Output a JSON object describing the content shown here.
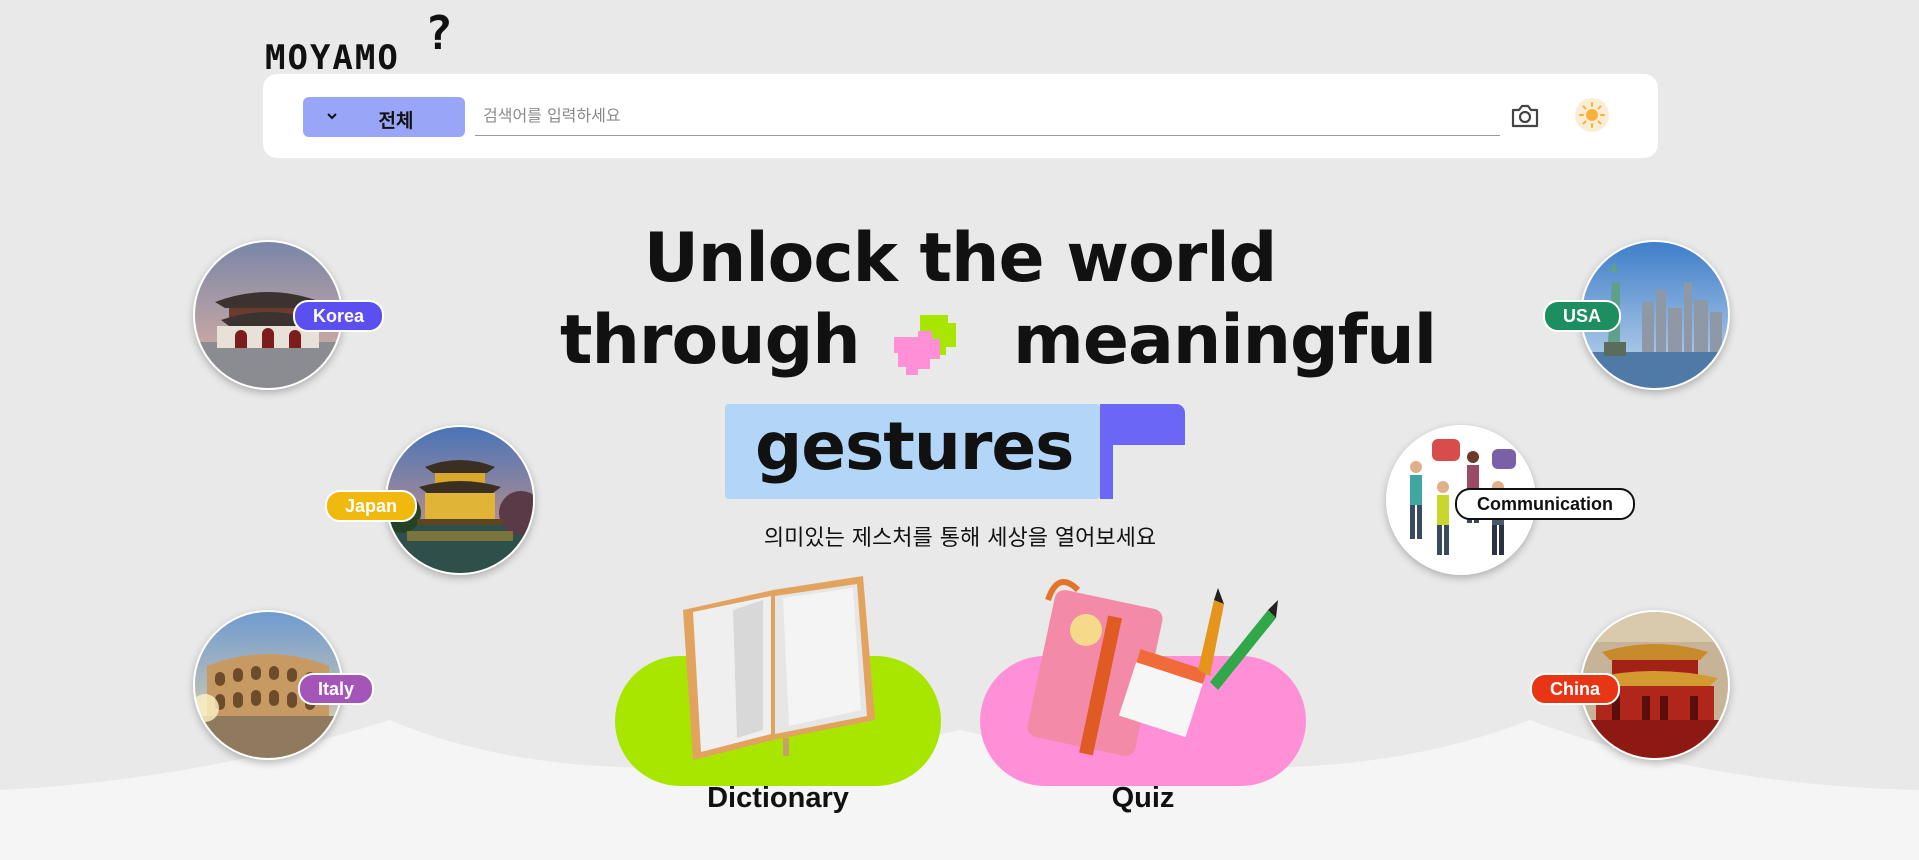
{
  "logo": {
    "text": "MOYAMO",
    "mark": "?"
  },
  "search": {
    "category": "전체",
    "placeholder": "검색어를 입력하세요",
    "camera_icon": "camera-icon",
    "theme_icon": "sun-icon"
  },
  "hero": {
    "line1": "Unlock the world",
    "line2a": "through",
    "line2b": "meaningful",
    "line3": "gestures",
    "subtitle": "의미있는 제스처를 통해 세상을 열어보세요"
  },
  "countries": {
    "korea": "Korea",
    "japan": "Japan",
    "italy": "Italy",
    "usa": "USA",
    "communication": "Communication",
    "china": "China"
  },
  "colors": {
    "korea": "#5b4ff0",
    "japan": "#f0b90e",
    "italy": "#a456b8",
    "usa": "#1d8e60",
    "china": "#e83515",
    "dictionary_blob": "#a8e600",
    "quiz_blob": "#ff8fd6",
    "accent": "#6b66f5"
  },
  "cards": {
    "dictionary": "Dictionary",
    "quiz": "Quiz"
  }
}
